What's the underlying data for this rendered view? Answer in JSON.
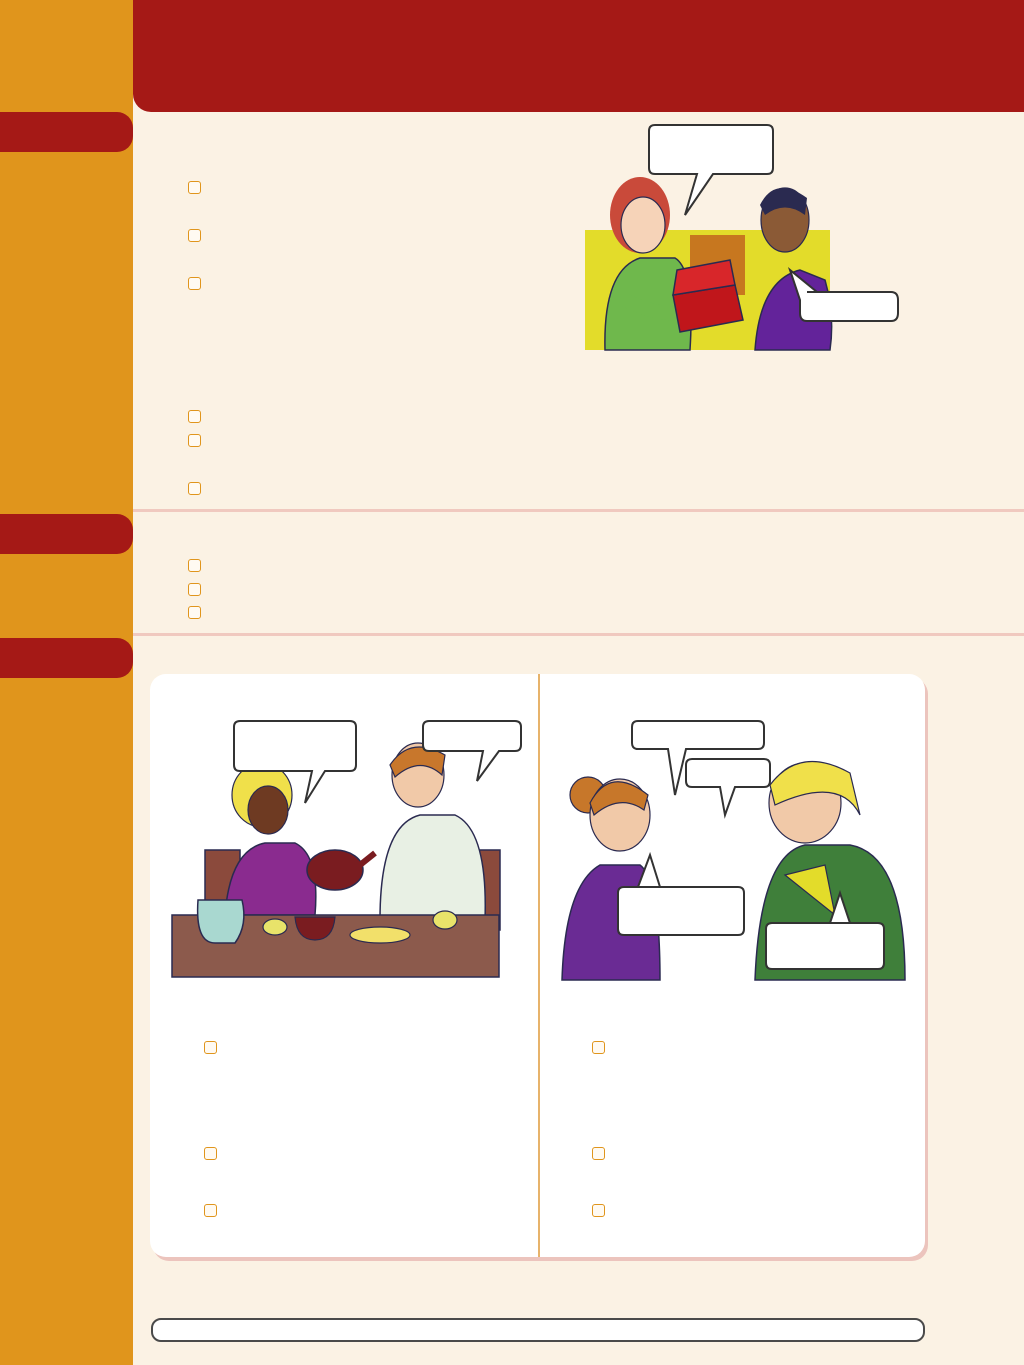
{
  "colors": {
    "sidebar": "#e0951c",
    "header": "#a51916",
    "page": "#fbf2e4",
    "checkbox_border": "#e0951c",
    "divider": "#f0c9bf"
  },
  "sections": [
    {
      "name": "section-1",
      "checkbox_count": 6
    },
    {
      "name": "section-2",
      "checkbox_count": 3
    },
    {
      "name": "section-3",
      "checkbox_count": 6
    }
  ],
  "illustrations": [
    "gift-exchange-illustration",
    "tea-table-illustration",
    "two-women-talking-illustration"
  ]
}
